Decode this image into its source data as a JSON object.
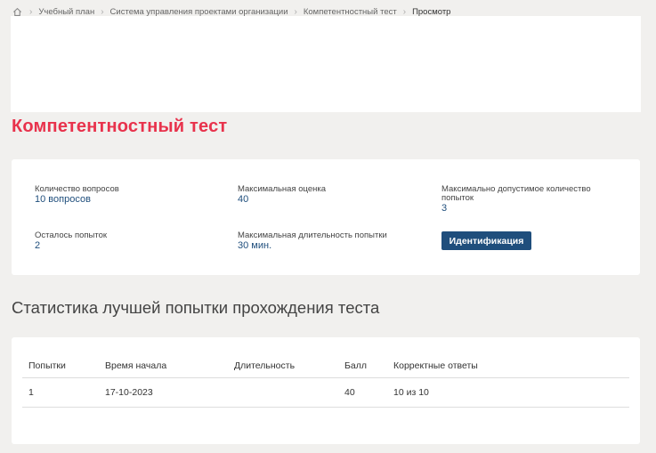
{
  "breadcrumb": {
    "home_icon": "home-icon",
    "items": [
      "Учебный план",
      "Система управления проектами организации",
      "Компетентностный тест"
    ],
    "current": "Просмотр"
  },
  "page_title": "Компетентностный тест",
  "info": {
    "questions_count": {
      "label": "Количество вопросов",
      "value": "10 вопросов"
    },
    "max_score": {
      "label": "Максимальная оценка",
      "value": "40"
    },
    "max_attempts": {
      "label": "Максимально допустимое количество попыток",
      "value": "3"
    },
    "remaining_attempts": {
      "label": "Осталось попыток",
      "value": "2"
    },
    "max_duration": {
      "label": "Максимальная длительность попытки",
      "value": "30 мин."
    },
    "identify_button": "Идентификация"
  },
  "stats": {
    "title": "Статистика лучшей попытки прохождения теста",
    "columns": [
      "Попытки",
      "Время начала",
      "Длительность",
      "Балл",
      "Корректные ответы"
    ],
    "rows": [
      {
        "attempt": "1",
        "start": "17-10-2023",
        "duration": "",
        "score": "40",
        "correct": "10 из 10"
      }
    ]
  },
  "colors": {
    "accent": "#e8324c",
    "primary": "#1f4e7c",
    "background": "#f1f0ee"
  }
}
